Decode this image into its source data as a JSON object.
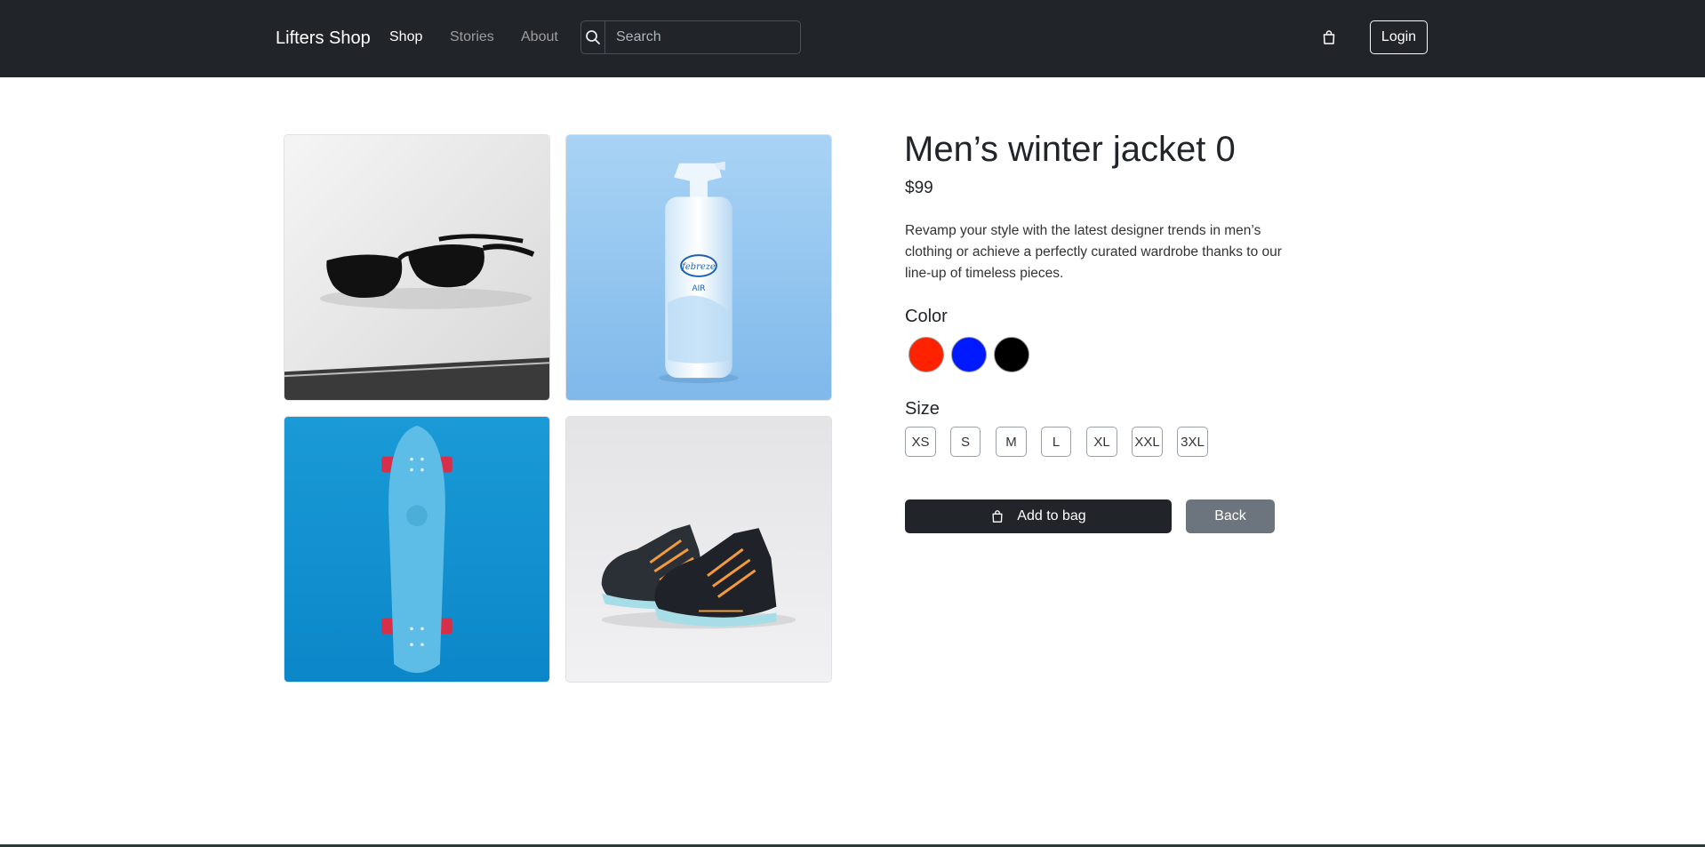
{
  "navbar": {
    "brand": "Lifters Shop",
    "links": [
      {
        "label": "Shop",
        "active": true
      },
      {
        "label": "Stories",
        "active": false
      },
      {
        "label": "About",
        "active": false
      }
    ],
    "search_placeholder": "Search",
    "search_icon": "search-icon",
    "bag_icon": "shopping-bag-icon",
    "login_label": "Login"
  },
  "gallery": {
    "images": [
      {
        "subject": "sunglasses"
      },
      {
        "subject": "air-freshener-bottle"
      },
      {
        "subject": "skateboard"
      },
      {
        "subject": "sneakers"
      }
    ]
  },
  "product": {
    "title": "Men’s winter jacket 0",
    "price": "$99",
    "description": "Revamp your style with the latest designer trends in men’s clothing or achieve a perfectly curated wardrobe thanks to our line-up of timeless pieces.",
    "color_label": "Color",
    "colors": [
      "#ff2200",
      "#0019ff",
      "#000000"
    ],
    "size_label": "Size",
    "sizes": [
      "XS",
      "S",
      "M",
      "L",
      "XL",
      "XXL",
      "3XL"
    ],
    "add_to_bag_label": "Add to bag",
    "back_label": "Back"
  }
}
